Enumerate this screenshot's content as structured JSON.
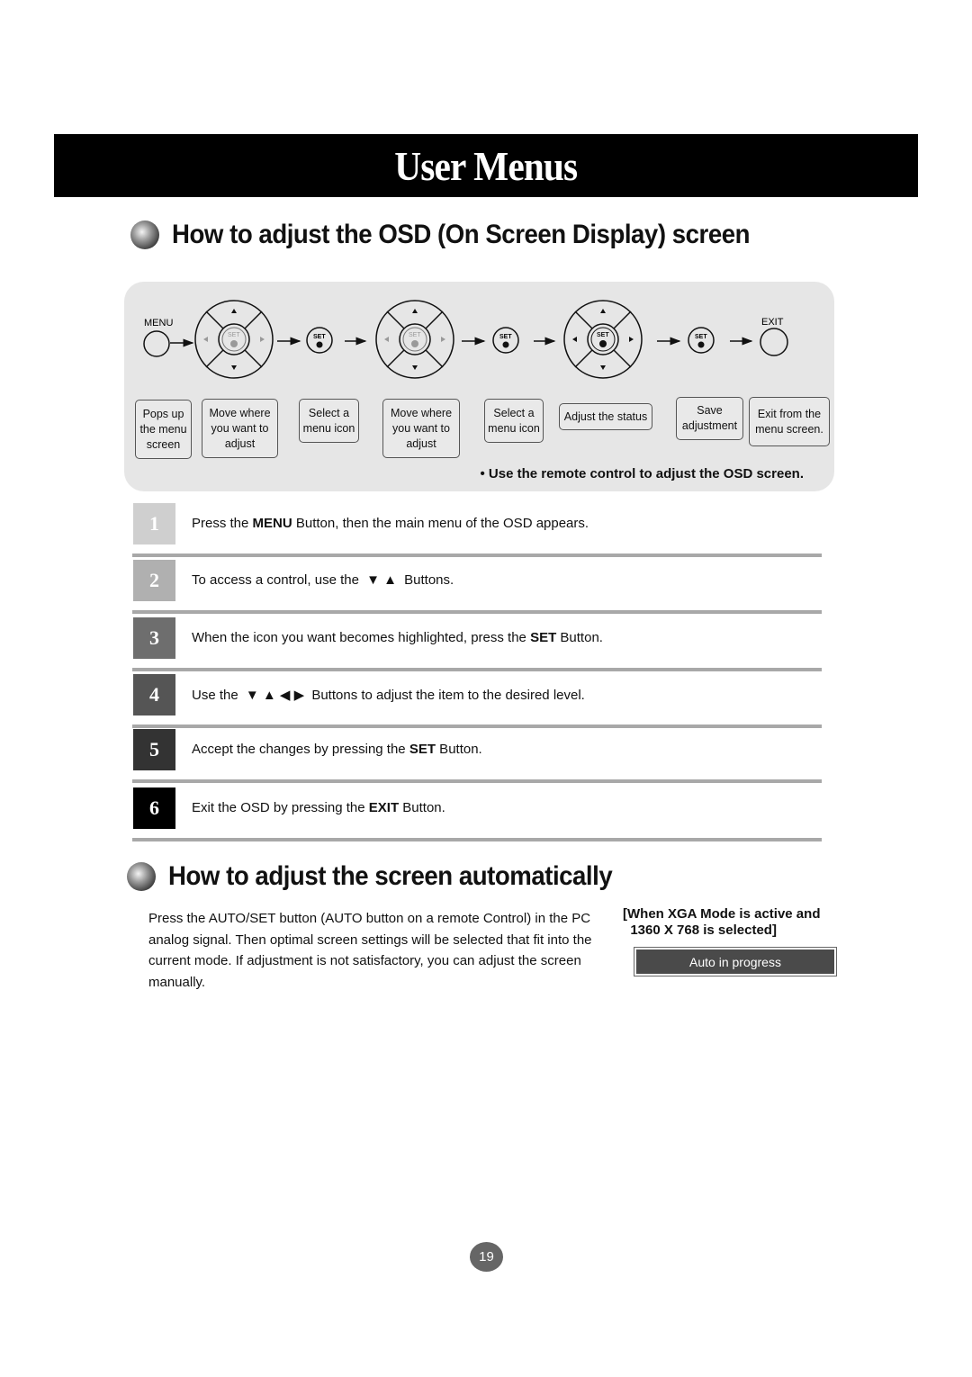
{
  "page_title": "User Menus",
  "section_osd": {
    "heading": "How to adjust the OSD (On Screen Display) screen",
    "diagram": {
      "menu_label": "MENU",
      "exit_label": "EXIT",
      "set_label": "SET",
      "captions": [
        "Pops up\nthe menu\nscreen",
        "Move where\nyou want to\nadjust",
        "Select a\nmenu icon",
        "Move where\nyou want to\nadjust",
        "Select a\nmenu icon",
        "Adjust the status",
        "Save\nadjustment",
        "Exit from the\nmenu screen."
      ],
      "note": "• Use the remote control to adjust the OSD screen."
    },
    "steps": [
      {
        "num": "1",
        "color": "#cfcfcf",
        "pre": "Press the ",
        "bold": "MENU",
        "post": " Button, then the main menu of the OSD appears."
      },
      {
        "num": "2",
        "color": "#b0b0b0",
        "pre": "To access a control, use the ",
        "arrows": "▼ ▲",
        "post": " Buttons."
      },
      {
        "num": "3",
        "color": "#6e6e6e",
        "pre": "When the icon you want becomes highlighted, press the ",
        "bold": "SET",
        "post": " Button."
      },
      {
        "num": "4",
        "color": "#555555",
        "pre": "Use the ",
        "arrows": "▼ ▲  ◀  ▶",
        "post": " Buttons to adjust the item to the desired level."
      },
      {
        "num": "5",
        "color": "#333333",
        "pre": "Accept the changes by pressing the ",
        "bold": "SET",
        "post": " Button."
      },
      {
        "num": "6",
        "color": "#000000",
        "pre": "Exit the OSD by pressing the ",
        "bold": "EXIT",
        "post": " Button."
      }
    ]
  },
  "section_auto": {
    "heading": "How to adjust the screen automatically",
    "body": "Press the AUTO/SET button (AUTO button on a remote Control) in the PC analog signal. Then optimal screen settings will be selected that fit into the current mode. If adjustment is not satisfactory, you can adjust the screen manually.",
    "note_line1": "[When XGA Mode is active and",
    "note_line2": "  1360 X 768 is selected]",
    "status_box": "Auto in progress"
  },
  "page_number": "19"
}
